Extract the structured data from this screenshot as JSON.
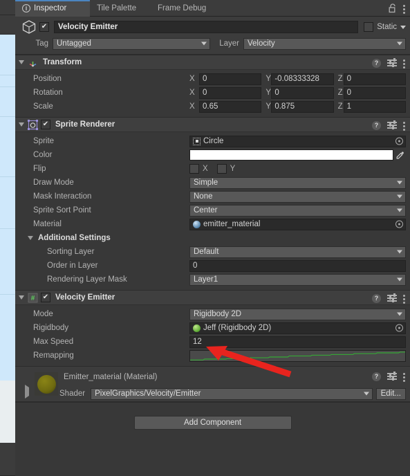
{
  "window": {
    "tabs": [
      {
        "label": "Inspector",
        "icon": "info-icon",
        "active": true
      },
      {
        "label": "Tile Palette",
        "active": false
      },
      {
        "label": "Frame Debug",
        "active": false
      }
    ],
    "lock_icon": "unlocked-padlock-icon",
    "menu_icon": "kebab-menu-icon"
  },
  "gameobject": {
    "icon": "cube-icon",
    "enabled_checkbox": "✔",
    "name": "Velocity Emitter",
    "static_label": "Static",
    "static_checked": false,
    "tag_label": "Tag",
    "tag_value": "Untagged",
    "layer_label": "Layer",
    "layer_value": "Velocity"
  },
  "transform": {
    "title": "Transform",
    "icon": "transform-axis-icon",
    "help_icon": "help-icon",
    "settings_icon": "preset-sliders-icon",
    "menu_icon": "kebab-menu-icon",
    "rows": [
      {
        "label": "Position",
        "x": "0",
        "y": "-0.08333328",
        "z": "0"
      },
      {
        "label": "Rotation",
        "x": "0",
        "y": "0",
        "z": "0"
      },
      {
        "label": "Scale",
        "x": "0.65",
        "y": "0.875",
        "z": "1"
      }
    ],
    "axis_labels": [
      "X",
      "Y",
      "Z"
    ]
  },
  "sprite_renderer": {
    "title": "Sprite Renderer",
    "icon": "sprite-renderer-icon",
    "enabled": true,
    "sprite_label": "Sprite",
    "sprite_value": "Circle",
    "color_label": "Color",
    "color_value": "#ffffff",
    "eyedropper_icon": "eyedropper-icon",
    "flip_label": "Flip",
    "flip_x_label": "X",
    "flip_y_label": "Y",
    "draw_mode_label": "Draw Mode",
    "draw_mode_value": "Simple",
    "mask_interaction_label": "Mask Interaction",
    "mask_interaction_value": "None",
    "sprite_sort_point_label": "Sprite Sort Point",
    "sprite_sort_point_value": "Center",
    "material_label": "Material",
    "material_value": "emitter_material",
    "additional_settings_title": "Additional Settings",
    "sorting_layer_label": "Sorting Layer",
    "sorting_layer_value": "Default",
    "order_in_layer_label": "Order in Layer",
    "order_in_layer_value": "0",
    "rendering_layer_mask_label": "Rendering Layer Mask",
    "rendering_layer_mask_value": "Layer1"
  },
  "velocity_emitter": {
    "title": "Velocity Emitter",
    "icon": "csharp-script-icon",
    "script_glyph": "#",
    "enabled": true,
    "mode_label": "Mode",
    "mode_value": "Rigidbody 2D",
    "rigidbody_label": "Rigidbody",
    "rigidbody_value": "Jeff (Rigidbody 2D)",
    "max_speed_label": "Max Speed",
    "max_speed_value": "12",
    "remapping_label": "Remapping",
    "remapping_curve_color": "#2fc12f"
  },
  "material_editor": {
    "title": "Emitter_material (Material)",
    "preview_icon": "material-sphere-preview",
    "shader_label": "Shader",
    "shader_value": "PixelGraphics/Velocity/Emitter",
    "edit_button": "Edit..."
  },
  "footer": {
    "add_component": "Add Component"
  },
  "annotation": {
    "arrow_color": "#e8241e",
    "arrow_points_at": "Max Speed value field"
  }
}
